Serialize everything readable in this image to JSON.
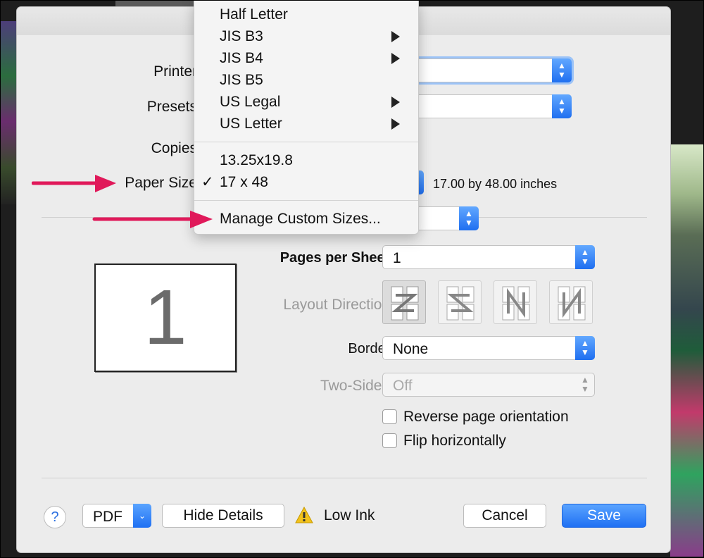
{
  "labels": {
    "printer": "Printer",
    "presets": "Presets",
    "copies": "Copies",
    "paper_size": "Paper Size",
    "paper_size_info": "17.00 by 48.00 inches"
  },
  "layout_panel": {
    "preview_page_number": "1",
    "pages_per_sheet_label": "Pages per Sheet:",
    "pages_per_sheet_value": "1",
    "layout_direction_label": "Layout Direction:",
    "border_label": "Border:",
    "border_value": "None",
    "two_sided_label": "Two-Sided:",
    "two_sided_value": "Off",
    "reverse_orientation_label": "Reverse page orientation",
    "flip_horizontally_label": "Flip horizontally"
  },
  "paper_menu": {
    "items": [
      {
        "label": "Half Letter",
        "submenu": false
      },
      {
        "label": "JIS B3",
        "submenu": true
      },
      {
        "label": "JIS B4",
        "submenu": true
      },
      {
        "label": "JIS B5",
        "submenu": false
      },
      {
        "label": "US Legal",
        "submenu": true
      },
      {
        "label": "US Letter",
        "submenu": true
      }
    ],
    "custom_items": [
      {
        "label": "13.25x19.8",
        "checked": false
      },
      {
        "label": "17 x 48",
        "checked": true
      }
    ],
    "checkmark": "✓",
    "manage_label": "Manage Custom Sizes..."
  },
  "footer": {
    "help_label": "?",
    "pdf_label": "PDF",
    "hide_details_label": "Hide Details",
    "low_ink_label": "Low Ink",
    "cancel_label": "Cancel",
    "save_label": "Save"
  },
  "colors": {
    "accent": "#1f70f3",
    "annotation_arrow": "#e0195a",
    "warning": "#f2c21b"
  }
}
